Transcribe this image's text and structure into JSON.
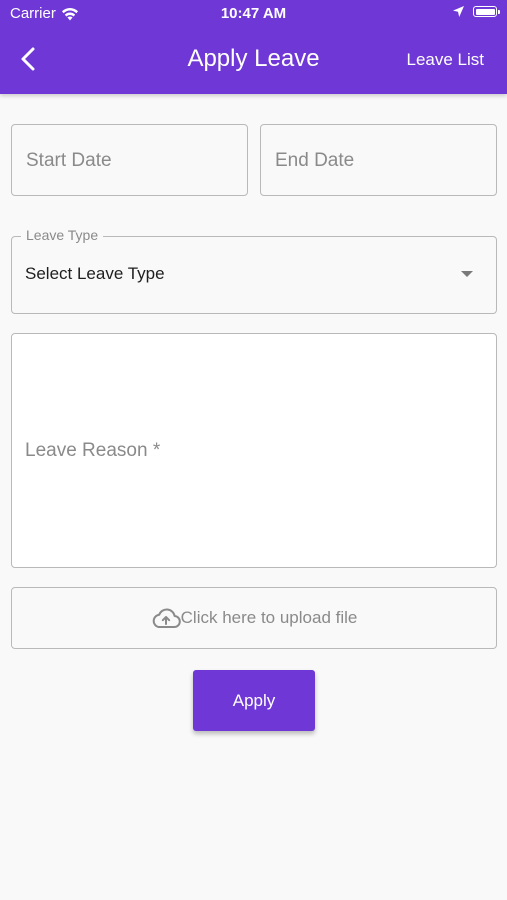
{
  "status_bar": {
    "carrier": "Carrier",
    "time": "10:47 AM"
  },
  "header": {
    "title": "Apply Leave",
    "action_label": "Leave List",
    "background_color": "#6f38d6"
  },
  "form": {
    "start_date": {
      "placeholder": "Start Date"
    },
    "end_date": {
      "placeholder": "End Date"
    },
    "leave_type": {
      "label": "Leave Type",
      "value": "Select Leave Type"
    },
    "reason": {
      "placeholder": "Leave Reason *"
    },
    "upload": {
      "label": "Click here to upload file",
      "icon": "cloud-upload-icon"
    },
    "submit_label": "Apply"
  }
}
